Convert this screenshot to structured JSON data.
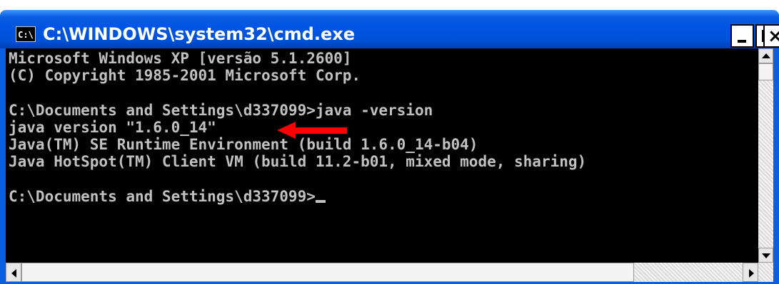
{
  "window": {
    "title": "C:\\WINDOWS\\system32\\cmd.exe",
    "icon_label": "C:\\",
    "icon": "console-icon",
    "minimize_icon": "minimize-icon",
    "maximize_icon": "maximize-icon",
    "close_icon": "close-icon",
    "close_glyph": "×"
  },
  "console": {
    "lines": [
      "Microsoft Windows XP [versão 5.1.2600]",
      "(C) Copyright 1985-2001 Microsoft Corp.",
      "",
      "C:\\Documents and Settings\\d337099>java -version",
      "java version \"1.6.0_14\"",
      "Java(TM) SE Runtime Environment (build 1.6.0_14-b04)",
      "Java HotSpot(TM) Client VM (build 11.2-b01, mixed mode, sharing)",
      "",
      "C:\\Documents and Settings\\d337099>"
    ],
    "text_color": "#c0c0c0",
    "background": "#000000"
  },
  "annotation": {
    "icon": "red-arrow-icon",
    "color": "#ff0000"
  },
  "scrollbars": {
    "up_icon": "scroll-up-arrow-icon",
    "down_icon": "scroll-down-arrow-icon",
    "left_icon": "scroll-left-arrow-icon",
    "right_icon": "scroll-right-arrow-icon"
  },
  "theme": {
    "titlebar_blue": "#0054e3"
  }
}
